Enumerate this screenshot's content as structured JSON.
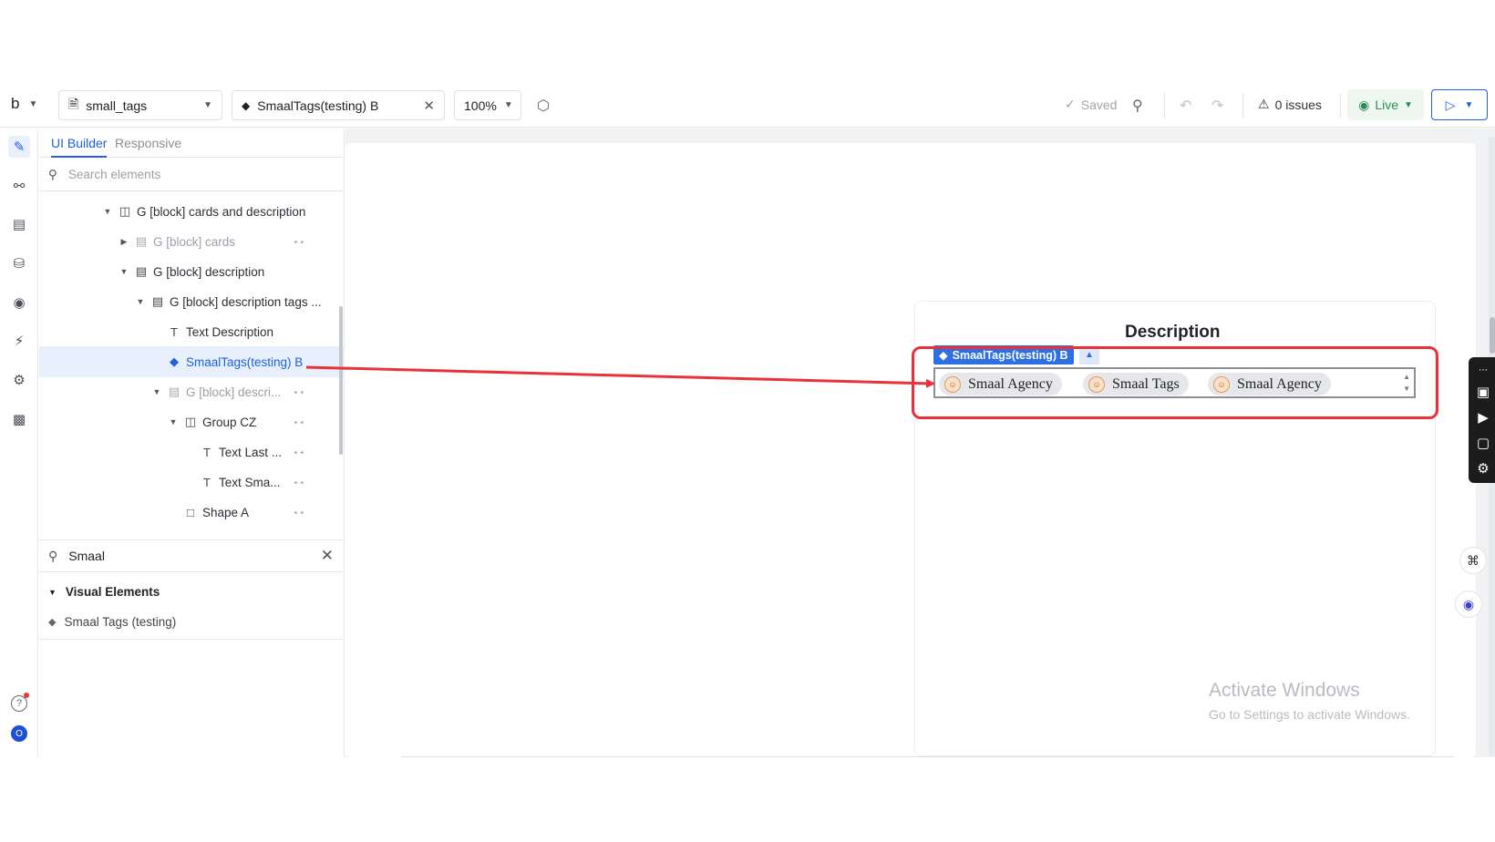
{
  "toolbar": {
    "logo": "b",
    "app_select": "small_tags",
    "page_tab": "SmaalTags(testing) B",
    "zoom": "100%",
    "saved_label": "Saved",
    "issues_label": "0 issues",
    "live_label": "Live"
  },
  "panel": {
    "tab_builder": "UI Builder",
    "tab_responsive": "Responsive",
    "search_placeholder": "Search elements",
    "tree": [
      {
        "label": "G [block] cards and description"
      },
      {
        "label": "G [block] cards"
      },
      {
        "label": "G [block] description"
      },
      {
        "label": "G [block] description tags ..."
      },
      {
        "label": "Text Description"
      },
      {
        "label": "SmaalTags(testing) B"
      },
      {
        "label": "G [block] descri..."
      },
      {
        "label": "Group CZ"
      },
      {
        "label": "Text Last ..."
      },
      {
        "label": "Text Sma..."
      },
      {
        "label": "Shape A"
      }
    ],
    "search_value": "Smaal",
    "section_title": "Visual Elements",
    "section_item": "Smaal Tags (testing)",
    "avatar_letter": "O"
  },
  "canvas": {
    "description_title": "Description",
    "element_label": "SmaalTags(testing) B",
    "tags": [
      "Smaal Agency",
      "Smaal Tags",
      "Smaal Agency"
    ],
    "watermark_title": "Activate Windows",
    "watermark_sub": "Go to Settings to activate Windows."
  },
  "colors": {
    "accent": "#1f5fe0",
    "highlight": "#e8323a",
    "live": "#2e8b57"
  }
}
